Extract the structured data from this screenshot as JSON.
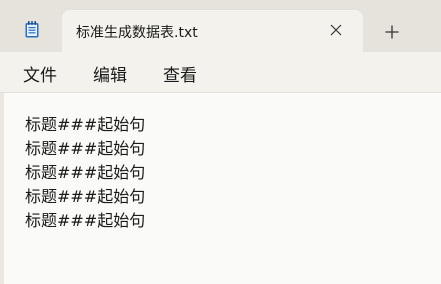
{
  "tab": {
    "title": "标准生成数据表.txt",
    "close_icon": "close-icon",
    "app_icon": "notepad-icon"
  },
  "new_tab": {
    "glyph": "+",
    "icon": "plus-icon"
  },
  "menu": {
    "items": [
      {
        "label": "文件"
      },
      {
        "label": "编辑"
      },
      {
        "label": "查看"
      }
    ]
  },
  "editor": {
    "lines": [
      "标题###起始句",
      "标题###起始句",
      "标题###起始句",
      "标题###起始句",
      "标题###起始句"
    ]
  },
  "colors": {
    "accent": "#1f6fb5"
  }
}
